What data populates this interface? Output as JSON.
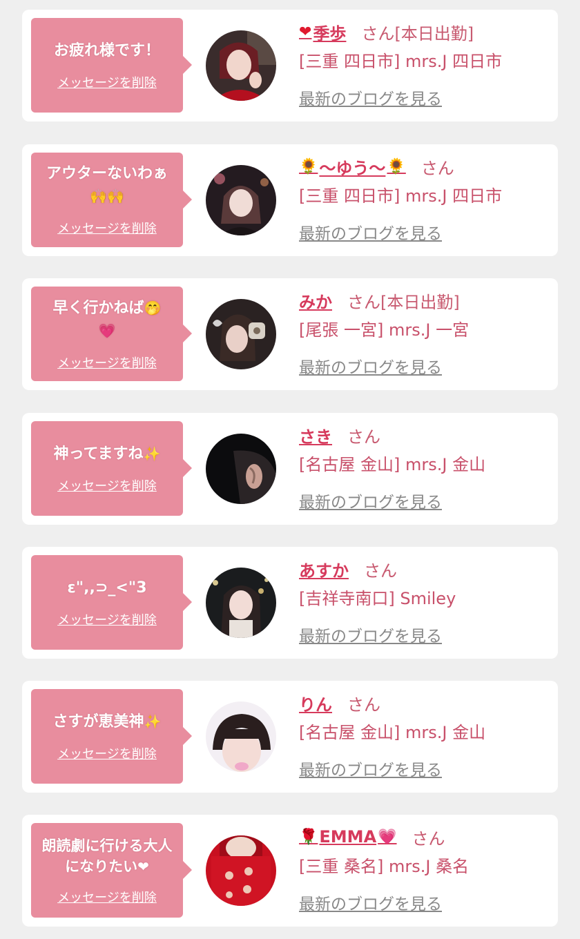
{
  "delete_label": "メッセージを削除",
  "blog_label": "最新のブログを見る",
  "honorific": "さん",
  "colors": {
    "bubble": "#e88d9e",
    "name": "#d63a5c",
    "shop": "#c8506a",
    "blog": "#888888",
    "background": "#efefef"
  },
  "items": [
    {
      "message": "お疲れ様です！",
      "name_prefix_icon": "red-heart-icon",
      "name_prefix": "❤",
      "name": "季歩",
      "name_suffix": "",
      "status": "[本日出勤]",
      "shop": "[三重 四日市] mrs.J 四日市"
    },
    {
      "message": "アウターないわぁ",
      "message_emoji": "🙌🙌",
      "name_prefix_icon": "sunflower-icon",
      "name_prefix": "🌻",
      "name": "〜ゆう〜",
      "name_suffix": "🌻",
      "status": "",
      "shop": "[三重 四日市] mrs.J 四日市"
    },
    {
      "message": "早く行かねば",
      "message_emoji": "🤭",
      "message_line2": "💗",
      "name": "みか",
      "status": "[本日出勤]",
      "shop": "[尾張 一宮] mrs.J 一宮"
    },
    {
      "message": "神ってますね",
      "message_emoji": "✨",
      "name": "さき",
      "status": "",
      "shop": "[名古屋 金山] mrs.J 金山"
    },
    {
      "message": "ε\",,⊃_<\"3",
      "name": "あすか",
      "status": "",
      "shop": "[吉祥寺南口] Smiley"
    },
    {
      "message": "さすが恵美神",
      "message_emoji": "✨",
      "name": "りん",
      "status": "",
      "shop": "[名古屋 金山] mrs.J 金山"
    },
    {
      "message": "朗読劇に行ける大人になりたい",
      "message_emoji": "❤",
      "name_prefix_icon": "rose-icon",
      "name_prefix": "🌹",
      "name": "EMMA",
      "name_suffix": "💗",
      "status": "",
      "shop": "[三重 桑名] mrs.J 桑名"
    }
  ]
}
